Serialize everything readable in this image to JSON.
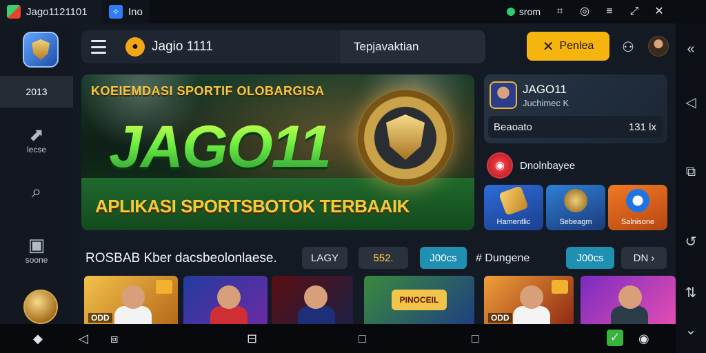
{
  "titlebar": {
    "tab1_title": "Jago1121101",
    "tab2_title": "Ino",
    "network_label": "srom",
    "icons": [
      "grid-icon",
      "help-icon",
      "menu-icon",
      "restore-icon",
      "close-icon"
    ]
  },
  "leftbar": {
    "active_label": "2013",
    "items": [
      {
        "icon": "trend-icon",
        "label": "lecse"
      },
      {
        "icon": "search-icon",
        "label": ""
      },
      {
        "icon": "store-icon",
        "label": "soone"
      }
    ]
  },
  "topnav": {
    "brand": "Jagio 1111",
    "link": "Tepjavaktian",
    "cta_label": "Penlea"
  },
  "hero": {
    "top_text": "KOEIEMDASI SPORTIF OLOBARGISA",
    "main_text": "JAGO11",
    "sub_text": "APLIKASI SPORTSBOTOK TERBAAIK"
  },
  "side_card": {
    "name": "JAGO11",
    "subtitle": "Juchimec K",
    "balance_label": "Beaoato",
    "balance_value": "131 lx",
    "live_label": "Dnolnbayee"
  },
  "tiles": [
    {
      "label": "Hamentlic"
    },
    {
      "label": "Sebeagm"
    },
    {
      "label": "Salnisone"
    }
  ],
  "filterbar": {
    "title": "ROSBAB Kber dacsbeolonlaese.",
    "chips": [
      "LAGY",
      "552.",
      "J00cs",
      "J00cs",
      "DN"
    ],
    "plain_label": "# Dungene"
  },
  "games": [
    {
      "tag": "ODD"
    },
    {
      "tag": ""
    },
    {
      "tag": ""
    },
    {
      "logo": "PINOCEIL"
    },
    {
      "tag": "ODD"
    },
    {
      "tag": ""
    }
  ]
}
